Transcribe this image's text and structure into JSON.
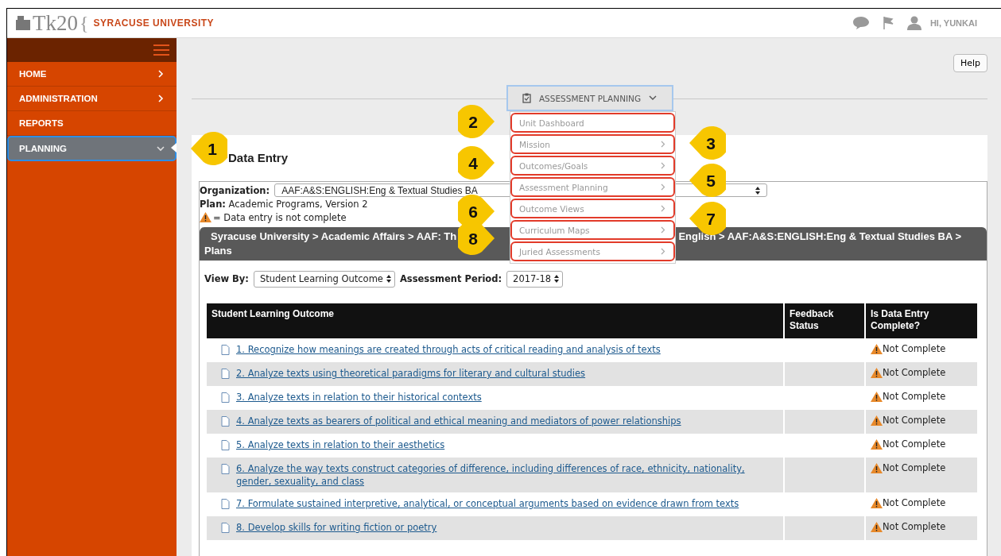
{
  "header": {
    "logo": "Tk20",
    "logo_brace": "{",
    "university": "SYRACUSE UNIVERSITY",
    "greeting": "HI, YUNKAI"
  },
  "sidebar": {
    "items": [
      {
        "label": "HOME",
        "has_arrow": true,
        "expanded": false,
        "selected": false
      },
      {
        "label": "ADMINISTRATION",
        "has_arrow": true,
        "expanded": false,
        "selected": false
      },
      {
        "label": "REPORTS",
        "has_arrow": false,
        "selected": false
      },
      {
        "label": "PLANNING",
        "has_arrow": true,
        "expanded": true,
        "selected": true
      }
    ]
  },
  "help_button": "Help",
  "menu_button": {
    "label": "ASSESSMENT PLANNING"
  },
  "menu": {
    "items": [
      {
        "label": "Unit Dashboard",
        "has_arrow": false
      },
      {
        "label": "Mission",
        "has_arrow": true
      },
      {
        "label": "Outcomes/Goals",
        "has_arrow": true
      },
      {
        "label": "Assessment Planning",
        "has_arrow": true
      },
      {
        "label": "Outcome Views",
        "has_arrow": true
      },
      {
        "label": "Curriculum Maps",
        "has_arrow": true
      },
      {
        "label": "Juried Assessments",
        "has_arrow": true
      }
    ]
  },
  "page_title": "Data Entry",
  "organization": {
    "label": "Organization:",
    "value": "AAF:A&S:ENGLISH:Eng & Textual Studies BA"
  },
  "plan": {
    "label": "Plan:",
    "value": "Academic Programs,  Version 2"
  },
  "legend": "= Data entry is not complete",
  "breadcrumb": [
    "Syracuse University > Academic Affairs > AAF: Th",
    "English > AAF:A&S:ENGLISH:Eng & Textual Studies BA >",
    "Plans"
  ],
  "view_by": {
    "label": "View By:",
    "value": "Student Learning Outcome"
  },
  "assessment_period": {
    "label": "Assessment Period:",
    "value": "2017-18"
  },
  "table": {
    "columns": [
      "Student Learning Outcome",
      "Feedback Status",
      "Is Data Entry Complete?"
    ],
    "rows": [
      {
        "outcome": "1. Recognize how meanings are created through acts of critical reading and analysis of texts",
        "complete": "Not Complete"
      },
      {
        "outcome": "2. Analyze texts using theoretical paradigms for literary and cultural studies",
        "complete": "Not Complete"
      },
      {
        "outcome": "3. Analyze texts in relation to their historical contexts",
        "complete": "Not Complete"
      },
      {
        "outcome": "4. Analyze texts as bearers of political and ethical meaning and mediators of power relationships",
        "complete": "Not Complete"
      },
      {
        "outcome": "5. Analyze texts in relation to their aesthetics",
        "complete": "Not Complete"
      },
      {
        "outcome": "6. Analyze the way texts construct categories of difference, including differences of race, ethnicity, nationality, gender, sexuality, and class",
        "complete": "Not Complete"
      },
      {
        "outcome": "7. Formulate sustained interpretive, analytical, or conceptual arguments based on evidence drawn from texts",
        "complete": "Not Complete"
      },
      {
        "outcome": "8. Develop skills for writing fiction or poetry",
        "complete": "Not Complete"
      }
    ]
  },
  "callouts": [
    {
      "number": "1"
    },
    {
      "number": "2"
    },
    {
      "number": "3"
    },
    {
      "number": "4"
    },
    {
      "number": "5"
    },
    {
      "number": "6"
    },
    {
      "number": "7"
    },
    {
      "number": "8"
    }
  ]
}
